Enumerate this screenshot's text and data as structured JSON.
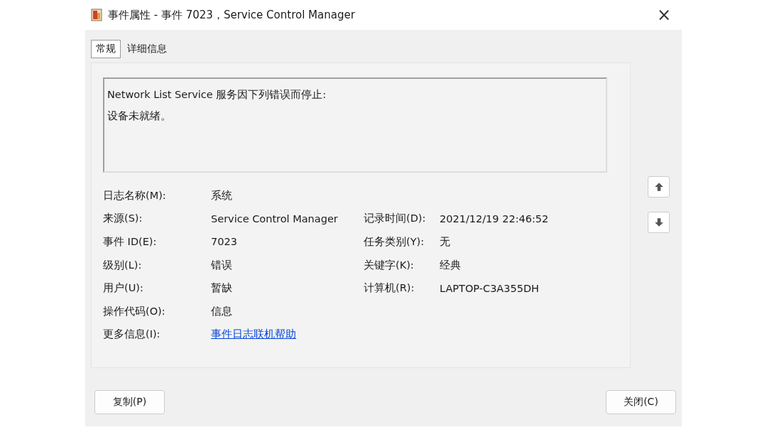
{
  "window": {
    "title": "事件属性 - 事件 7023，Service Control Manager",
    "close": "×"
  },
  "tabs": [
    {
      "label": "常规",
      "selected": true
    },
    {
      "label": "详细信息",
      "selected": false
    }
  ],
  "message": [
    "Network List Service 服务因下列错误而停止:",
    "设备未就绪。"
  ],
  "fields": [
    {
      "label": "日志名称(M):",
      "value": "系统"
    },
    {
      "label": "来源(S):",
      "value": "Service Control Manager",
      "label2": "记录时间(D):",
      "value2": "2021/12/19 22:46:52"
    },
    {
      "label": "事件 ID(E):",
      "value": "7023",
      "label2": "任务类别(Y):",
      "value2": "无"
    },
    {
      "label": "级别(L):",
      "value": "错误",
      "label2": "关键字(K):",
      "value2": "经典"
    },
    {
      "label": "用户(U):",
      "value": "暂缺",
      "label2": "计算机(R):",
      "value2": "LAPTOP-C3A355DH"
    },
    {
      "label": "操作代码(O):",
      "value": "信息"
    },
    {
      "label": "更多信息(I):",
      "value": "事件日志联机帮助",
      "kind": "link"
    }
  ],
  "buttons": [
    {
      "label": "复制(P)"
    },
    {
      "label": "关闭(C)"
    }
  ]
}
